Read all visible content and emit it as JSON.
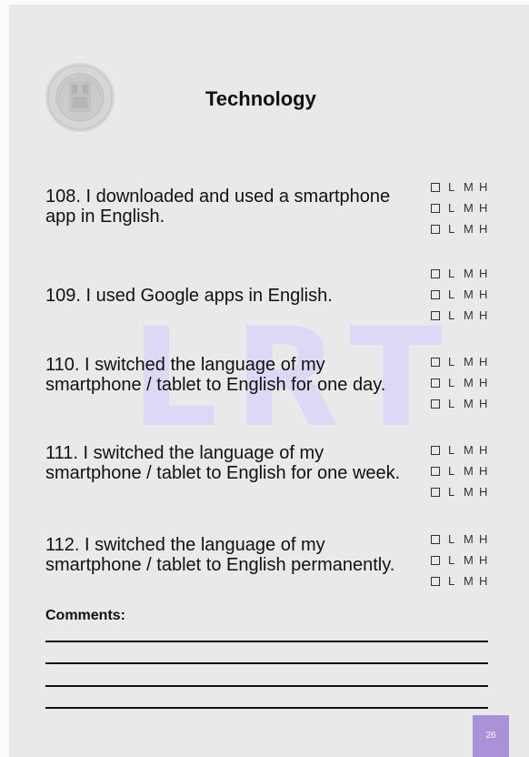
{
  "page": {
    "title": "Technology",
    "watermark": "LRT",
    "page_number": "26",
    "comments_label": "Comments:",
    "comment_line_count": 4
  },
  "logo": {
    "icon": "university-seal-icon"
  },
  "levels": [
    "L",
    "M",
    "H"
  ],
  "items": [
    {
      "text": "108. I downloaded and used a smartphone app in English."
    },
    {
      "text": "109. I used Google apps in English."
    },
    {
      "text": "110. I switched the language of my smartphone / tablet to English for one day."
    },
    {
      "text": "111. I switched the language of my smartphone / tablet to English for one week."
    },
    {
      "text": "112. I switched the language of my smartphone / tablet to English permanently."
    }
  ],
  "colors": {
    "page_background": "#e9e9ea",
    "watermark": "#dcd8f5",
    "page_number_badge": "#a992d8",
    "text": "#111111"
  }
}
